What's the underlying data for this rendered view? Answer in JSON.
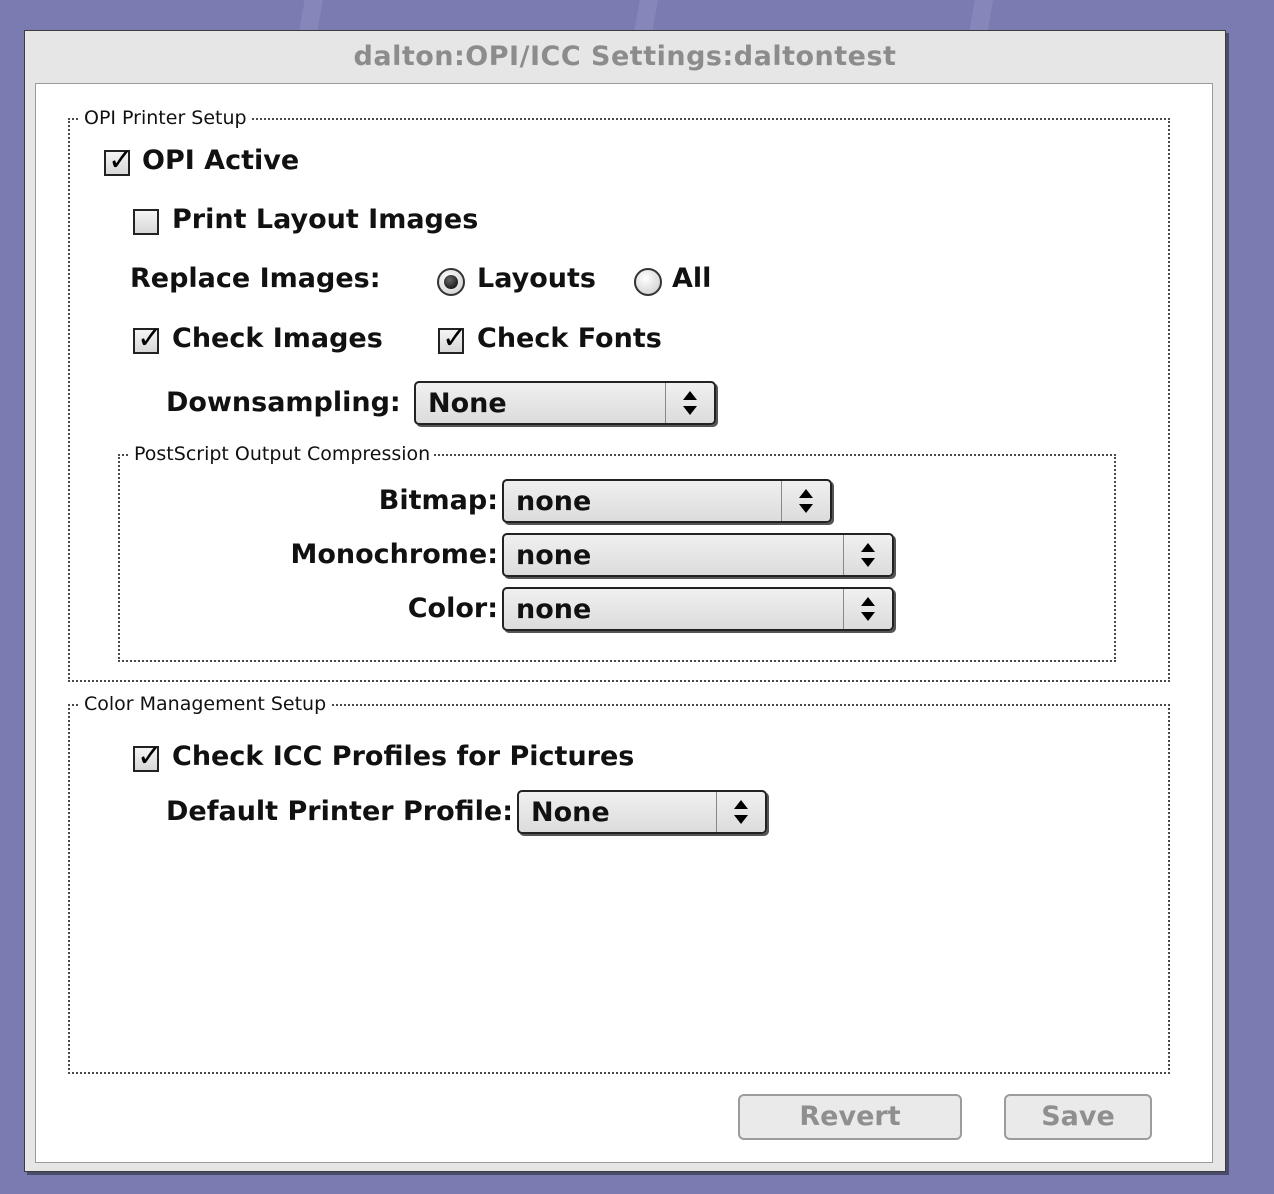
{
  "window": {
    "title": "dalton:OPI/ICC Settings:daltontest"
  },
  "opi_setup": {
    "legend": "OPI Printer Setup",
    "opi_active": {
      "label": "OPI Active",
      "checked": true
    },
    "print_layout_images": {
      "label": "Print Layout Images",
      "checked": false
    },
    "replace_images": {
      "label": "Replace Images:",
      "options": [
        {
          "label": "Layouts",
          "selected": true
        },
        {
          "label": "All",
          "selected": false
        }
      ]
    },
    "check_images": {
      "label": "Check Images",
      "checked": true
    },
    "check_fonts": {
      "label": "Check Fonts",
      "checked": true
    },
    "downsampling": {
      "label": "Downsampling:",
      "value": "None"
    },
    "compression": {
      "legend": "PostScript Output Compression",
      "bitmap": {
        "label": "Bitmap:",
        "value": "none"
      },
      "monochrome": {
        "label": "Monochrome:",
        "value": "none"
      },
      "color": {
        "label": "Color:",
        "value": "none"
      }
    }
  },
  "color_management": {
    "legend": "Color Management Setup",
    "check_icc": {
      "label": "Check ICC Profiles for Pictures",
      "checked": true
    },
    "default_printer_profile": {
      "label": "Default Printer Profile:",
      "value": "None"
    }
  },
  "buttons": {
    "revert": "Revert",
    "save": "Save"
  },
  "glyphs": {
    "check": "✓",
    "popup_arrows": "up-down-arrows-icon"
  }
}
